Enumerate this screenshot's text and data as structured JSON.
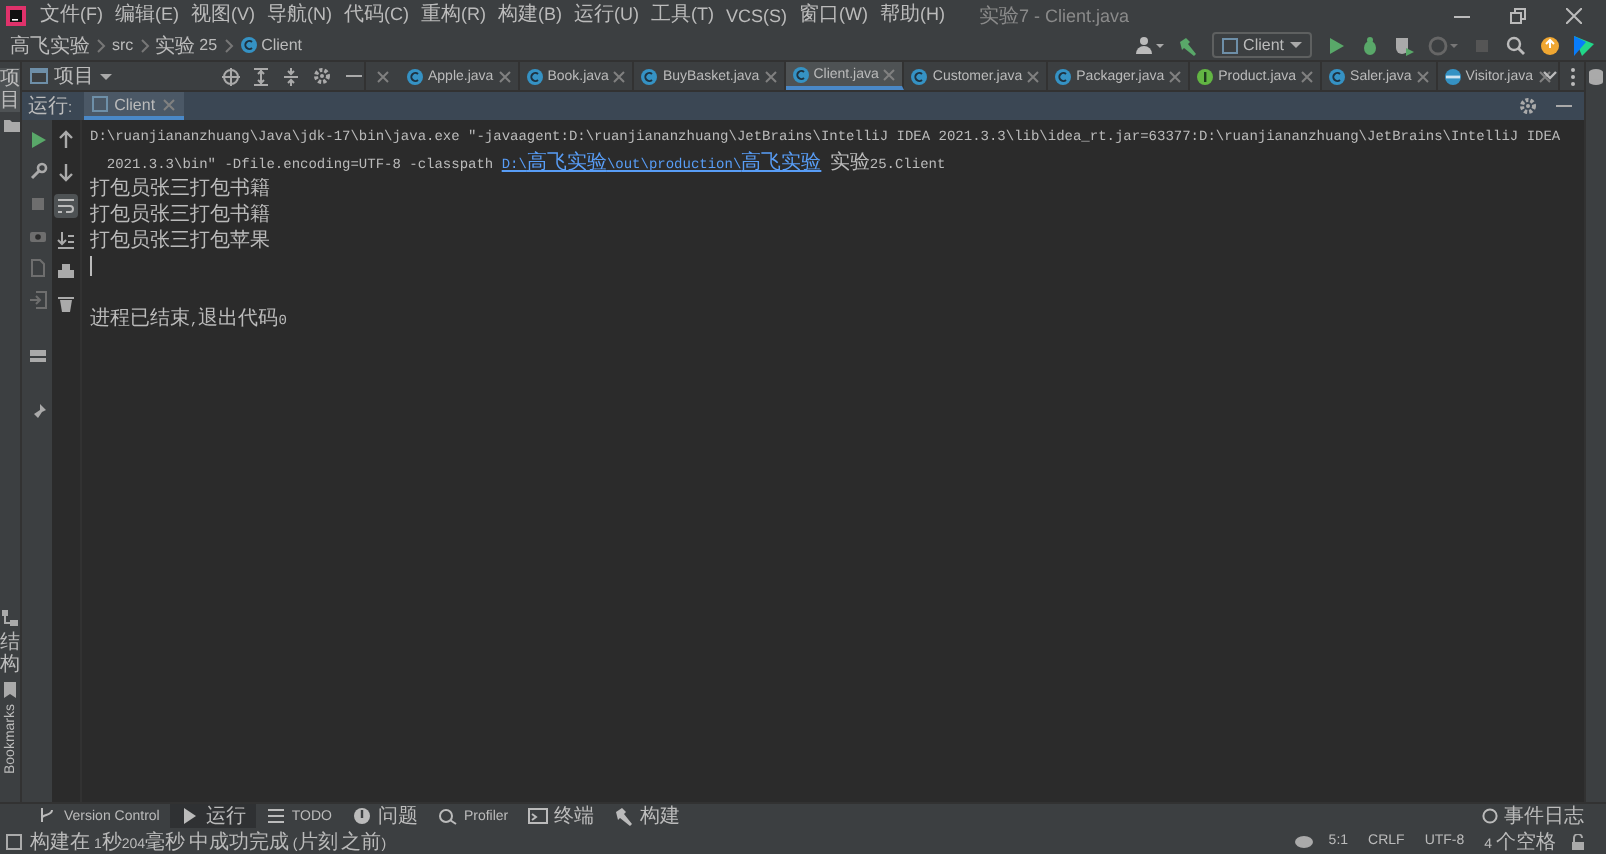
{
  "window": {
    "title": "实验7 - Client.java"
  },
  "menu": [
    {
      "label": "文件(F)"
    },
    {
      "label": "编辑(E)"
    },
    {
      "label": "视图(V)"
    },
    {
      "label": "导航(N)"
    },
    {
      "label": "代码(C)"
    },
    {
      "label": "重构(R)"
    },
    {
      "label": "构建(B)"
    },
    {
      "label": "运行(U)"
    },
    {
      "label": "工具(T)"
    },
    {
      "label": "VCS(S)"
    },
    {
      "label": "窗口(W)"
    },
    {
      "label": "帮助(H)"
    }
  ],
  "breadcrumb": [
    {
      "label": "高飞实验",
      "kind": "project"
    },
    {
      "label": "src",
      "kind": "folder"
    },
    {
      "label": "实验25",
      "kind": "package"
    },
    {
      "label": "Client",
      "kind": "class"
    }
  ],
  "run_config": {
    "label": "Client"
  },
  "project_panel": {
    "label": "项目"
  },
  "editor_tabs": [
    {
      "label": "Apple.java",
      "kind": "class",
      "selected": false
    },
    {
      "label": "Book.java",
      "kind": "class",
      "selected": false
    },
    {
      "label": "BuyBasket.java",
      "kind": "class",
      "selected": false
    },
    {
      "label": "Client.java",
      "kind": "class",
      "selected": true
    },
    {
      "label": "Customer.java",
      "kind": "class",
      "selected": false
    },
    {
      "label": "Packager.java",
      "kind": "class",
      "selected": false
    },
    {
      "label": "Product.java",
      "kind": "interface",
      "selected": false
    },
    {
      "label": "Saler.java",
      "kind": "class",
      "selected": false
    },
    {
      "label": "Visitor.java",
      "kind": "abstract",
      "selected": false
    }
  ],
  "left_stripe": {
    "top": [
      {
        "label": "项目",
        "selected": true
      }
    ],
    "bottom": [
      {
        "label": "结构",
        "kind": "vertical_cjk",
        "selected": false
      },
      {
        "label": "Bookmarks",
        "kind": "rotated",
        "selected": false
      }
    ]
  },
  "run_panel": {
    "label": "运行:",
    "tabs": [
      {
        "label": "Client",
        "selected": true
      }
    ],
    "soft_wrap": true,
    "console": [
      {
        "kind": "text",
        "segments": [
          {
            "text": "D:\\ruanjiananzhuang\\Java\\jdk-17\\bin\\java.exe \"-javaagent:D:\\ruanjiananzhuang\\JetBrains\\IntelliJ IDEA 2021.3.3\\lib\\idea_rt.jar=63377:D:\\ruanjiananzhuang\\JetBrains\\IntelliJ IDEA",
            "link": false
          }
        ]
      },
      {
        "kind": "text",
        "segments": [
          {
            "text": "  2021.3.3\\bin\" -Dfile.encoding=UTF-8 -classpath ",
            "link": false
          },
          {
            "text": "D:\\高飞实验\\out\\production\\高飞实验",
            "link": true
          },
          {
            "text": " 实验25.Client",
            "link": false
          }
        ]
      },
      {
        "kind": "text",
        "segments": [
          {
            "text": "打包员张三打包书籍",
            "link": false
          }
        ]
      },
      {
        "kind": "text",
        "segments": [
          {
            "text": "打包员张三打包书籍",
            "link": false
          }
        ]
      },
      {
        "kind": "text",
        "segments": [
          {
            "text": "打包员张三打包苹果",
            "link": false
          }
        ]
      },
      {
        "kind": "caret"
      },
      {
        "kind": "blank"
      },
      {
        "kind": "text",
        "segments": [
          {
            "text": "进程已结束,退出代码0",
            "link": false
          }
        ]
      }
    ]
  },
  "tool_windows": [
    {
      "label": "Version Control",
      "kind": "vcs",
      "selected": false
    },
    {
      "label": "运行",
      "kind": "run",
      "selected": true
    },
    {
      "label": "TODO",
      "kind": "todo",
      "selected": false
    },
    {
      "label": "问题",
      "kind": "problems",
      "selected": false
    },
    {
      "label": "Profiler",
      "kind": "profiler",
      "selected": false
    },
    {
      "label": "终端",
      "kind": "terminal",
      "selected": false
    },
    {
      "label": "构建",
      "kind": "build",
      "selected": false
    }
  ],
  "event_log": {
    "label": "事件日志"
  },
  "status_bar": {
    "message": "构建在 1秒204毫秒 中成功完成 (片刻 之前)",
    "items": [
      "5:1",
      "CRLF",
      "UTF-8",
      "4 个空格"
    ]
  }
}
